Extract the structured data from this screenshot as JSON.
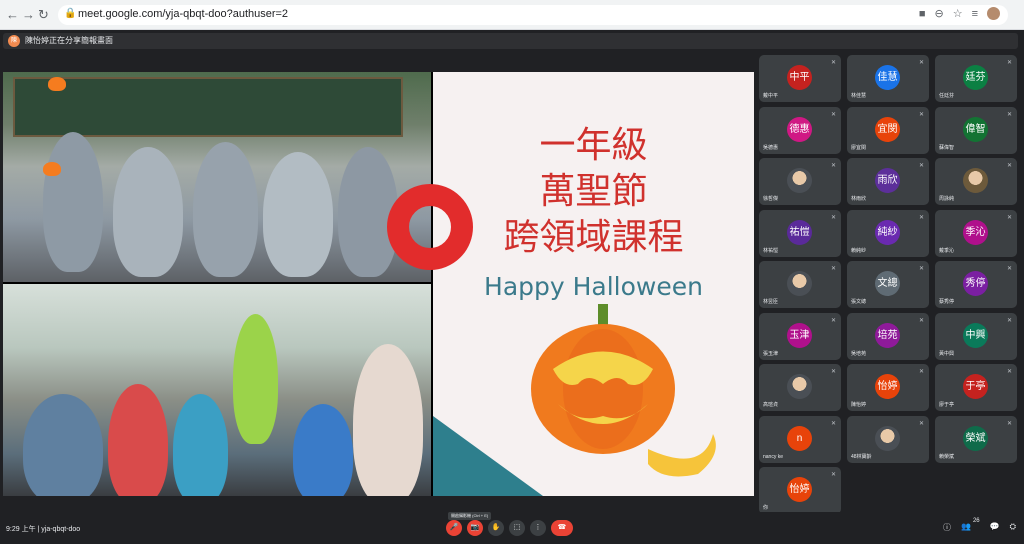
{
  "browser": {
    "back": "←",
    "forward": "→",
    "reload": "↻",
    "url": "meet.google.com/yja-qbqt-doo?authuser=2",
    "lock": "🔒",
    "icons": [
      "■",
      "⊖",
      "☆",
      "≡"
    ]
  },
  "banner": {
    "avatar_text": "陳",
    "text": "陳怡婷正在分享簡報畫面"
  },
  "slide": {
    "line1": "一年級",
    "line2": "萬聖節",
    "line3": "跨領域課程",
    "happy": "Happy Halloween"
  },
  "participants": [
    {
      "initials": "中平",
      "name": "戴中平",
      "color": "#c5221f"
    },
    {
      "initials": "佳慧",
      "name": "林佳慧",
      "color": "#1a73e8"
    },
    {
      "initials": "廷芬",
      "name": "任廷芬",
      "color": "#0b8043"
    },
    {
      "initials": "德惠",
      "name": "吳德惠",
      "color": "#d01884"
    },
    {
      "initials": "宜閔",
      "name": "廖宜閔",
      "color": "#e8430a"
    },
    {
      "initials": "偉智",
      "name": "蘇偉智",
      "color": "#137333"
    },
    {
      "initials": "",
      "name": "徐哲傑",
      "color": "#4a4f55"
    },
    {
      "initials": "雨欣",
      "name": "林雨欣",
      "color": "#5c2f9a"
    },
    {
      "initials": "",
      "name": "周詠純",
      "color": "#6d5a3b"
    },
    {
      "initials": "祐愷",
      "name": "林祐愷",
      "color": "#5a2a9a"
    },
    {
      "initials": "純紗",
      "name": "賴純紗",
      "color": "#6a2ab0"
    },
    {
      "initials": "季沁",
      "name": "戴季沁",
      "color": "#b0108c"
    },
    {
      "initials": "",
      "name": "林昱臣",
      "color": "#4a4f55"
    },
    {
      "initials": "文總",
      "name": "張文總",
      "color": "#5f6b74"
    },
    {
      "initials": "秀停",
      "name": "蔡秀停",
      "color": "#7b1fa2"
    },
    {
      "initials": "玉津",
      "name": "張玉津",
      "color": "#b0108c"
    },
    {
      "initials": "培苑",
      "name": "吳培苑",
      "color": "#8f1a9a"
    },
    {
      "initials": "中興",
      "name": "黃中興",
      "color": "#0a7a5a"
    },
    {
      "initials": "",
      "name": "高瑄貞",
      "color": "#4a4f55"
    },
    {
      "initials": "怡婷",
      "name": "陳怡婷",
      "color": "#e8430a"
    },
    {
      "initials": "于亭",
      "name": "廖于亭",
      "color": "#c5221f"
    },
    {
      "initials": "n",
      "name": "nancy ke",
      "color": "#e8430a"
    },
    {
      "initials": "",
      "name": "48林寶齡",
      "color": "#4a4f55"
    },
    {
      "initials": "榮斌",
      "name": "賴榮斌",
      "color": "#0f6b4a"
    },
    {
      "initials": "怡婷",
      "name": "你",
      "color": "#e8430a"
    }
  ],
  "footer": {
    "time": "9:29 上午  |  yja-qbqt-doo",
    "tooltip": "開啟攝影機 (Ctrl + E)",
    "participant_count": "26",
    "controls": [
      "🎤",
      "📷",
      "✋",
      "⬚",
      "⋮",
      "☎"
    ],
    "right_icons": [
      "ⓘ",
      "👥",
      "💬",
      "⛭"
    ]
  },
  "colors": {
    "accent_red": "#ea4335",
    "slide_red": "#d0312d",
    "slide_teal": "#3b7a8b"
  }
}
